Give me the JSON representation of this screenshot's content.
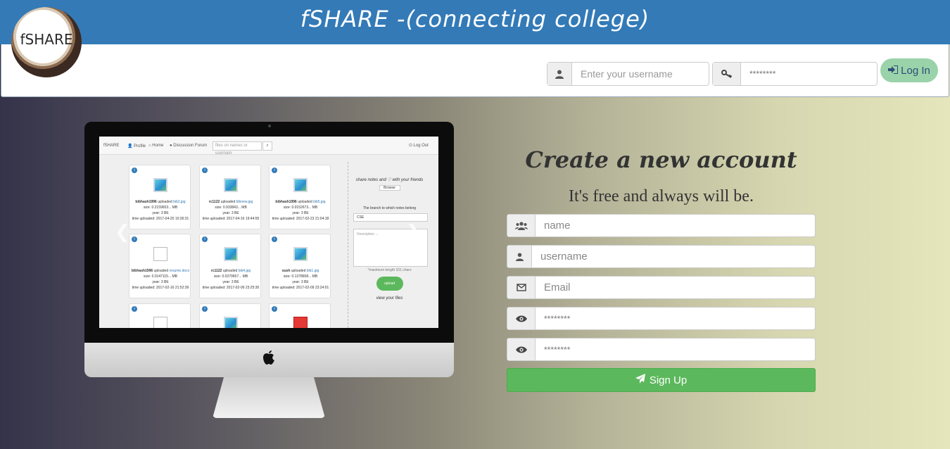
{
  "header": {
    "title": "fSHARE -(connecting college)",
    "logo_text": "fSHARE",
    "brand_color": "#337ab7"
  },
  "login": {
    "username_placeholder": "Enter your username",
    "password_placeholder": "********",
    "button_label": "Log In",
    "button_icon": "sign-in-icon"
  },
  "preview": {
    "nav": {
      "brand": "fSHARE",
      "profile": "Profile",
      "home": "Home",
      "forum": "Discussion Forum",
      "search_placeholder": "files on names or usernam",
      "logout": "Log Out"
    },
    "cards": [
      {
        "user": "bibhash1996",
        "file": "bib2.jpg",
        "size": "size: 0.2159653... MB",
        "year": "year: 3 BE",
        "time": "time uploaded: 2017-04-20 10:36:31",
        "kind": "image"
      },
      {
        "user": "rc1122",
        "file": "bibnew.jpg",
        "size": "size: 0.933843... MB",
        "year": "year: 3 BE",
        "time": "time uploaded: 2017-04-16 19:44:55",
        "kind": "image"
      },
      {
        "user": "bibhash1996",
        "file": "bib5.jpg",
        "size": "size: 0.0152673... MB",
        "year": "year: 3 BE",
        "time": "time uploaded: 2017-02-23 21:04:18",
        "kind": "image"
      },
      {
        "user": "bibhash1996",
        "file": "resume.docx",
        "size": "size: 0.0147115... MB",
        "year": "year: 3 BE",
        "time": "time uploaded: 2017-02-16 21:52:39",
        "kind": "doc"
      },
      {
        "user": "rc1122",
        "file": "bib4.jpg",
        "size": "size: 0.0379657... MB",
        "year": "year: 3 BE",
        "time": "time uploaded: 2017-02-09 23:25:30",
        "kind": "image"
      },
      {
        "user": "sush",
        "file": "bib1.jpg",
        "size": "size: 0.1378658... MB",
        "year": "year: 3 BE",
        "time": "time uploaded: 2017-02-09 23:24:01",
        "kind": "image"
      }
    ],
    "side": {
      "heading": "share notes and ♡ with your friends",
      "browse": "Browse",
      "branch_label": "The branch to which notes belong",
      "branch_value": "CSE",
      "desc_placeholder": "Description ...",
      "max_len": "*maximum length 101 chars",
      "upload": "upload",
      "view": "view your files"
    }
  },
  "signup": {
    "title": "Create a new account",
    "subtitle": "It's free and always will be.",
    "fields": [
      {
        "icon": "users-icon",
        "placeholder": "name"
      },
      {
        "icon": "user-icon",
        "placeholder": "username"
      },
      {
        "icon": "envelope-icon",
        "placeholder": "Email"
      },
      {
        "icon": "eye-icon",
        "placeholder": "********"
      },
      {
        "icon": "eye-icon",
        "placeholder": "********"
      }
    ],
    "button_label": "Sign Up",
    "button_color": "#5cb85c"
  }
}
